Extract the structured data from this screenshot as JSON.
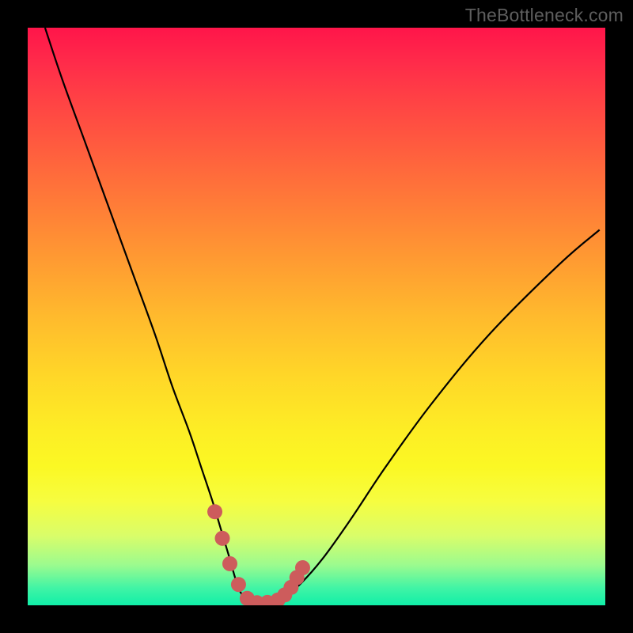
{
  "watermark": "TheBottleneck.com",
  "colors": {
    "curve": "#000000",
    "marker_fill": "#cd5c5c",
    "marker_stroke": "#cd5c5c",
    "bg_black": "#000000"
  },
  "chart_data": {
    "type": "line",
    "title": "",
    "xlabel": "",
    "ylabel": "",
    "xlim": [
      0,
      100
    ],
    "ylim": [
      0,
      100
    ],
    "grid": false,
    "series": [
      {
        "name": "bottleneck-curve",
        "x": [
          3,
          6,
          10,
          14,
          18,
          22,
          25,
          28,
          30,
          32,
          33.5,
          35,
          36,
          37,
          38.5,
          40,
          42,
          44,
          47,
          51,
          56,
          62,
          70,
          80,
          92,
          99
        ],
        "y": [
          100,
          91,
          80,
          69,
          58,
          47,
          38,
          30,
          24,
          18,
          13,
          8,
          4.5,
          2,
          0.8,
          0.5,
          0.6,
          1.2,
          3.5,
          8,
          15,
          24,
          35,
          47,
          59,
          65
        ]
      }
    ],
    "markers": {
      "name": "highlighted-points",
      "x": [
        32.4,
        33.7,
        35.0,
        36.5,
        38.0,
        39.7,
        41.5,
        43.3,
        44.5,
        45.6,
        46.6,
        47.6
      ],
      "y": [
        16.2,
        11.6,
        7.2,
        3.6,
        1.2,
        0.45,
        0.5,
        0.9,
        1.8,
        3.1,
        4.8,
        6.5
      ]
    },
    "background": {
      "type": "vertical-gradient",
      "stops": [
        {
          "pos": 0.0,
          "color": "#ff154a"
        },
        {
          "pos": 0.5,
          "color": "#ffba2d"
        },
        {
          "pos": 0.78,
          "color": "#fbf824"
        },
        {
          "pos": 1.0,
          "color": "#10efa8"
        }
      ]
    }
  }
}
